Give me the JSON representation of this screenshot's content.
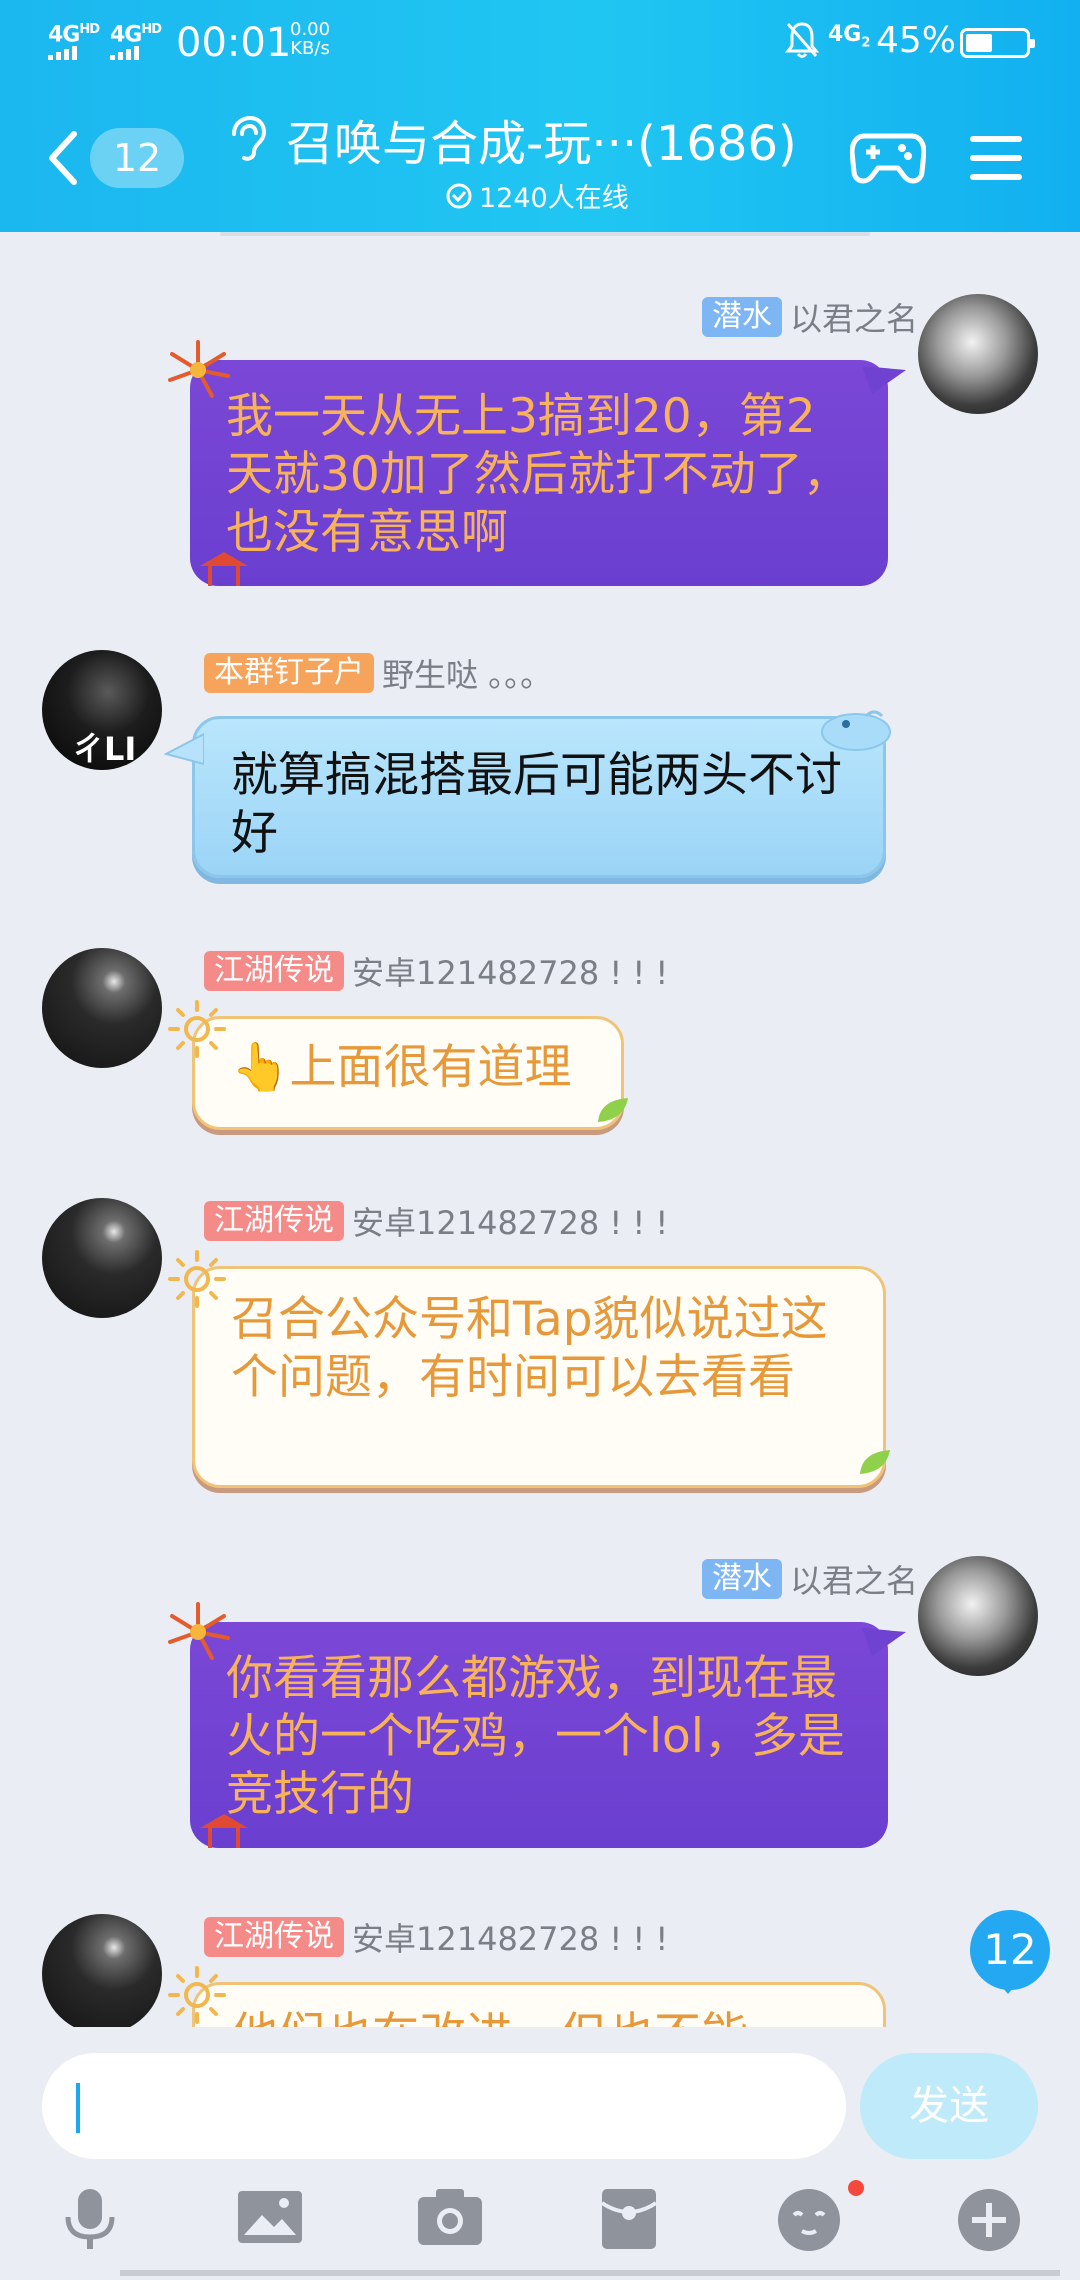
{
  "status_bar": {
    "signal_1": "4G",
    "signal_1_sup": "HD",
    "signal_2": "4G",
    "signal_2_sup": "HD",
    "time": "00:01",
    "speed_value": "0.00",
    "speed_unit": "KB/s",
    "network": "4G",
    "network_sub": "2",
    "battery_pct": "45%",
    "battery_level": 0.45
  },
  "nav": {
    "back_badge": "12",
    "title": "召唤与合成-玩···(1686)",
    "online": "1240人在线"
  },
  "messages": [
    {
      "side": "right",
      "tag": "潜水",
      "name": "以君之名",
      "text": "我一天从无上3搞到20，第2天就30加了然后就打不动了，也没有意思啊"
    },
    {
      "side": "left",
      "tag": "本群钉子户",
      "name": "野生哒  。。。",
      "text": "就算搞混搭最后可能两头不讨好",
      "avatar_text": "ㄔLI"
    },
    {
      "side": "left",
      "tag": "江湖传说",
      "name": "安卓121482728 ! ! !",
      "text": "👆上面很有道理"
    },
    {
      "side": "left",
      "tag": "江湖传说",
      "name": "安卓121482728 ! ! !",
      "text": "召合公众号和Tap貌似说过这个问题，有时间可以去看看"
    },
    {
      "side": "right",
      "tag": "潜水",
      "name": "以君之名",
      "text": "你看看那么都游戏，到现在最火的一个吃鸡，一个lol，多是竞技行的"
    },
    {
      "side": "left",
      "tag": "江湖传说",
      "name": "安卓121482728 ! ! !",
      "text": "他们也在改进，但也不能"
    }
  ],
  "unread_count": "12",
  "input": {
    "value": "",
    "send_label": "发送"
  },
  "toolbar_icons": [
    "microphone-icon",
    "image-icon",
    "camera-icon",
    "red-packet-icon",
    "emoji-icon",
    "plus-icon"
  ]
}
